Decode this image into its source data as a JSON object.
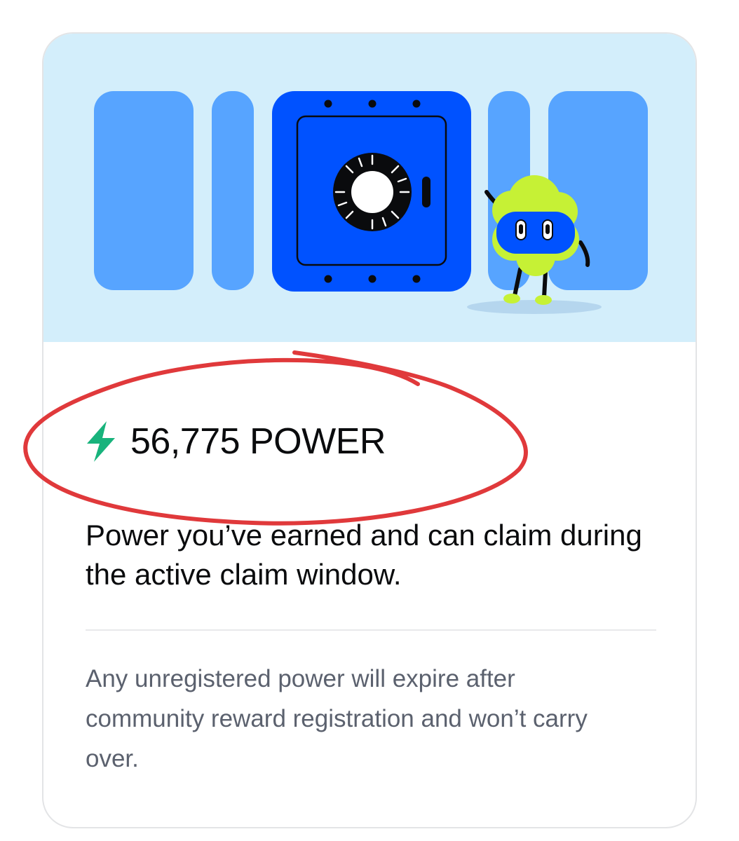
{
  "card": {
    "power_value": "56,775 POWER",
    "description": "Power you’ve earned and can claim during the active claim window.",
    "note": "Any unregistered power will expire after community reward registration and won’t carry over."
  },
  "icons": {
    "power": "lightning-bolt-icon",
    "hero": "vault-safe-illustration"
  },
  "colors": {
    "hero_bg": "#d3eefb",
    "vault_blue": "#0052ff",
    "side_panel_blue": "#57a4ff",
    "bolt_green": "#18b37c",
    "mascot_green": "#c6f135",
    "annotation_red": "#e0393b"
  }
}
